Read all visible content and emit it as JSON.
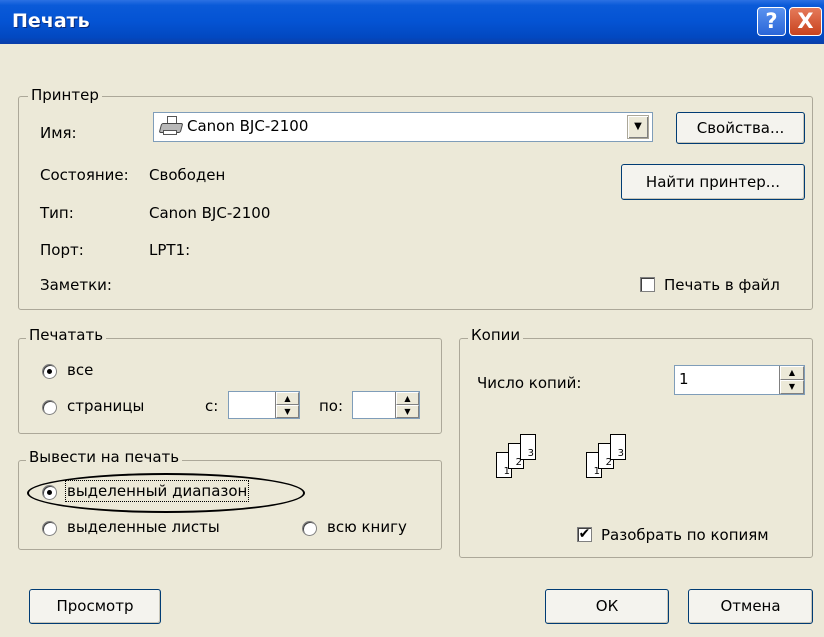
{
  "window": {
    "title": "Печать",
    "help_glyph": "?",
    "close_glyph": "X"
  },
  "printer": {
    "legend": "Принтер",
    "name_label": "Имя:",
    "name_value": "Canon BJC-2100",
    "status_label": "Состояние:",
    "status_value": "Свободен",
    "type_label": "Тип:",
    "type_value": "Canon BJC-2100",
    "port_label": "Порт:",
    "port_value": "LPT1:",
    "notes_label": "Заметки:",
    "notes_value": "",
    "properties_button": "Свойства...",
    "find_printer_button": "Найти принтер...",
    "print_to_file_label": "Печать в файл",
    "print_to_file_checked": false,
    "printer_icon": "printer-icon"
  },
  "print_range": {
    "legend": "Печатать",
    "all_label": "все",
    "pages_label": "страницы",
    "from_label": "с:",
    "to_label": "по:",
    "from_value": "",
    "to_value": "",
    "selected": "all"
  },
  "print_what": {
    "legend": "Вывести на печать",
    "selection_label": "выделенный диапазон",
    "sheets_label": "выделенные листы",
    "workbook_label": "всю книгу",
    "selected": "selection"
  },
  "copies": {
    "legend": "Копии",
    "count_label": "Число копий:",
    "count_value": "1",
    "collate_label": "Разобрать по копиям",
    "collate_checked": true,
    "collate_pages": [
      "1",
      "2",
      "3"
    ]
  },
  "footer": {
    "preview_button": "Просмотр",
    "ok_button": "ОК",
    "cancel_button": "Отмена"
  }
}
